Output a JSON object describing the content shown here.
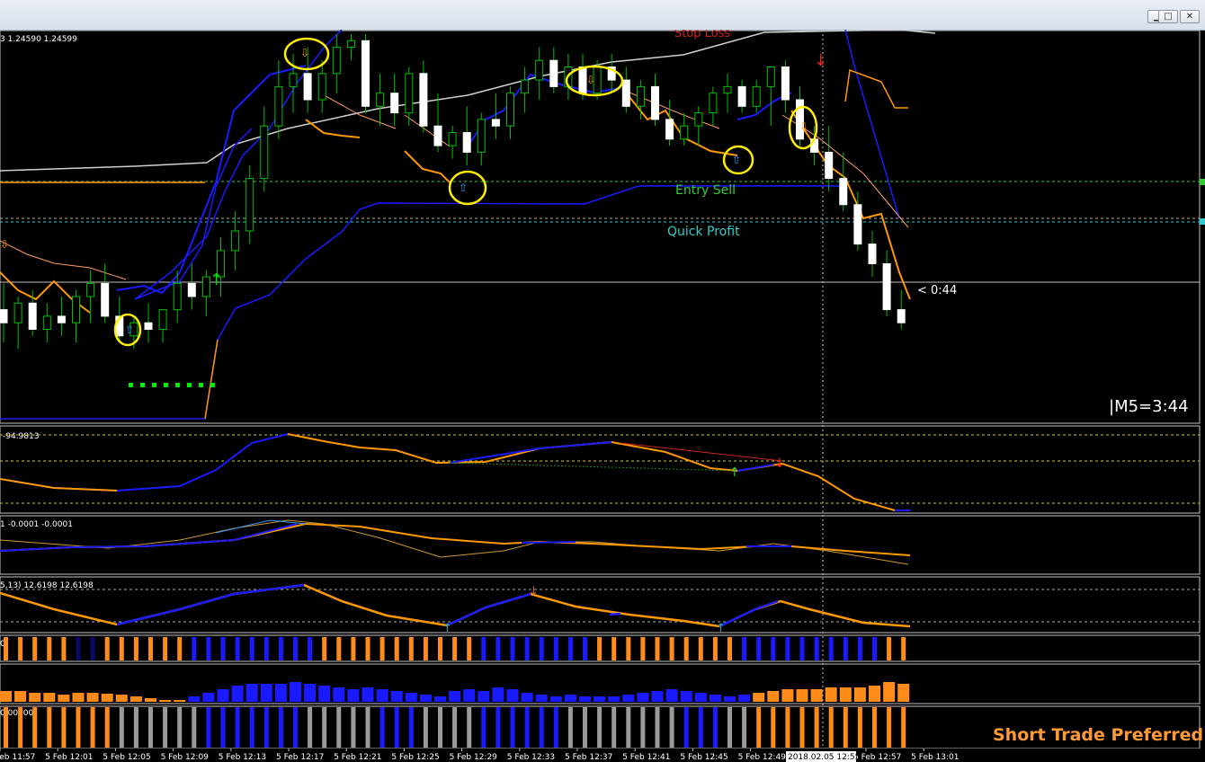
{
  "window": {
    "minimize_icon": "minimize-icon",
    "restore_icon": "restore-icon",
    "close_icon": "close-icon"
  },
  "main": {
    "price_readout": "3 1.24590 1.24599",
    "stop_loss_label": "Stop Loss",
    "entry_sell_label": "Entry Sell",
    "quick_profit_label": "Quick Profit",
    "countdown_label": "< 0:44",
    "timeframe_timer": "|M5=3:44",
    "colors": {
      "entry_sell": "#33cc33",
      "quick_profit": "#33cccc",
      "stop_loss": "#cc2222",
      "bull_candle": "#00c000",
      "bear_candle": "#ffffff"
    }
  },
  "panels": [
    {
      "name": "oscillator-1",
      "label": "-94.9813"
    },
    {
      "name": "oscillator-2",
      "label": "1  -0.0001 -0.0001"
    },
    {
      "name": "oscillator-3",
      "label": "5,13) 12.6198 12.6198"
    },
    {
      "name": "histogram-1",
      "label": "0"
    },
    {
      "name": "histogram-2",
      "label": ""
    },
    {
      "name": "histogram-3",
      "label": "0.00000",
      "overlay_text": "Short Trade Preferred"
    }
  ],
  "axis": {
    "time_labels": [
      "5 Feb 11:57",
      "5 Feb 12:01",
      "5 Feb 12:05",
      "5 Feb 12:09",
      "5 Feb 12:13",
      "5 Feb 12:17",
      "5 Feb 12:21",
      "5 Feb 12:25",
      "5 Feb 12:29",
      "5 Feb 12:33",
      "5 Feb 12:37",
      "5 Feb 12:41",
      "5 Feb 12:45",
      "5 Feb 12:49",
      "5 Feb 12:53",
      "5 Feb 12:57",
      "5 Feb 13:01"
    ],
    "crosshair_time": "2018.02.05 12:55"
  },
  "chart_data": {
    "type": "candlestick",
    "symbol_readout": "1.24590 1.24599",
    "timeframe": "M5",
    "candles": [
      {
        "o": 42,
        "h": 38,
        "l": 47,
        "c": 44
      },
      {
        "o": 44,
        "h": 40,
        "l": 48,
        "c": 41
      },
      {
        "o": 41,
        "h": 39,
        "l": 46,
        "c": 45
      },
      {
        "o": 45,
        "h": 41,
        "l": 47,
        "c": 43
      },
      {
        "o": 43,
        "h": 40,
        "l": 46,
        "c": 44
      },
      {
        "o": 44,
        "h": 39,
        "l": 47,
        "c": 40
      },
      {
        "o": 40,
        "h": 36,
        "l": 44,
        "c": 38
      },
      {
        "o": 38,
        "h": 35,
        "l": 44,
        "c": 43
      },
      {
        "o": 43,
        "h": 40,
        "l": 47,
        "c": 46
      },
      {
        "o": 46,
        "h": 43,
        "l": 48,
        "c": 44
      },
      {
        "o": 44,
        "h": 41,
        "l": 47,
        "c": 45
      },
      {
        "o": 45,
        "h": 42,
        "l": 47,
        "c": 42
      },
      {
        "o": 42,
        "h": 36,
        "l": 44,
        "c": 38
      },
      {
        "o": 38,
        "h": 35,
        "l": 42,
        "c": 40
      },
      {
        "o": 40,
        "h": 36,
        "l": 43,
        "c": 37
      },
      {
        "o": 37,
        "h": 31,
        "l": 40,
        "c": 33
      },
      {
        "o": 33,
        "h": 27,
        "l": 36,
        "c": 30
      },
      {
        "o": 30,
        "h": 20,
        "l": 32,
        "c": 22
      },
      {
        "o": 22,
        "h": 11,
        "l": 24,
        "c": 14
      },
      {
        "o": 14,
        "h": 4,
        "l": 16,
        "c": 8
      },
      {
        "o": 8,
        "h": 3,
        "l": 12,
        "c": 6
      },
      {
        "o": 6,
        "h": 2,
        "l": 12,
        "c": 10
      },
      {
        "o": 10,
        "h": 4,
        "l": 12,
        "c": 6
      },
      {
        "o": 6,
        "h": 0,
        "l": 9,
        "c": 2
      },
      {
        "o": 2,
        "h": 0,
        "l": 4,
        "c": 1
      },
      {
        "o": 1,
        "h": 0,
        "l": 12,
        "c": 11
      },
      {
        "o": 11,
        "h": 6,
        "l": 14,
        "c": 9
      },
      {
        "o": 9,
        "h": 6,
        "l": 14,
        "c": 12
      },
      {
        "o": 12,
        "h": 5,
        "l": 14,
        "c": 6
      },
      {
        "o": 6,
        "h": 4,
        "l": 15,
        "c": 14
      },
      {
        "o": 14,
        "h": 9,
        "l": 18,
        "c": 17
      },
      {
        "o": 17,
        "h": 14,
        "l": 19,
        "c": 15
      },
      {
        "o": 15,
        "h": 11,
        "l": 20,
        "c": 18
      },
      {
        "o": 18,
        "h": 12,
        "l": 20,
        "c": 13
      },
      {
        "o": 13,
        "h": 9,
        "l": 16,
        "c": 14
      },
      {
        "o": 14,
        "h": 8,
        "l": 16,
        "c": 9
      },
      {
        "o": 9,
        "h": 5,
        "l": 12,
        "c": 7
      },
      {
        "o": 7,
        "h": 2,
        "l": 10,
        "c": 4
      },
      {
        "o": 4,
        "h": 2,
        "l": 9,
        "c": 8
      },
      {
        "o": 8,
        "h": 3,
        "l": 10,
        "c": 5
      },
      {
        "o": 5,
        "h": 3,
        "l": 10,
        "c": 9
      },
      {
        "o": 9,
        "h": 4,
        "l": 10,
        "c": 5
      },
      {
        "o": 5,
        "h": 3,
        "l": 9,
        "c": 7
      },
      {
        "o": 7,
        "h": 5,
        "l": 12,
        "c": 11
      },
      {
        "o": 11,
        "h": 7,
        "l": 13,
        "c": 8
      },
      {
        "o": 8,
        "h": 6,
        "l": 14,
        "c": 13
      },
      {
        "o": 13,
        "h": 10,
        "l": 17,
        "c": 16
      },
      {
        "o": 16,
        "h": 12,
        "l": 17,
        "c": 14
      },
      {
        "o": 14,
        "h": 11,
        "l": 17,
        "c": 12
      },
      {
        "o": 12,
        "h": 8,
        "l": 14,
        "c": 9
      },
      {
        "o": 9,
        "h": 6,
        "l": 12,
        "c": 8
      },
      {
        "o": 8,
        "h": 7,
        "l": 12,
        "c": 11
      },
      {
        "o": 11,
        "h": 7,
        "l": 12,
        "c": 8
      },
      {
        "o": 8,
        "h": 6,
        "l": 14,
        "c": 5
      },
      {
        "o": 5,
        "h": 4,
        "l": 12,
        "c": 10
      },
      {
        "o": 10,
        "h": 8,
        "l": 17,
        "c": 16
      },
      {
        "o": 16,
        "h": 14,
        "l": 20,
        "c": 18
      },
      {
        "o": 18,
        "h": 14,
        "l": 24,
        "c": 22
      },
      {
        "o": 22,
        "h": 18,
        "l": 27,
        "c": 26
      },
      {
        "o": 26,
        "h": 24,
        "l": 33,
        "c": 32
      },
      {
        "o": 32,
        "h": 30,
        "l": 37,
        "c": 35
      },
      {
        "o": 35,
        "h": 33,
        "l": 43,
        "c": 42
      },
      {
        "o": 42,
        "h": 39,
        "l": 45,
        "c": 44
      }
    ],
    "price_levels": {
      "entry_sell": 22,
      "quick_profit": 28,
      "current": 37
    },
    "time_labels": [
      "5 Feb 11:57",
      "5 Feb 12:01",
      "5 Feb 12:05",
      "5 Feb 12:09",
      "5 Feb 12:13",
      "5 Feb 12:17",
      "5 Feb 12:21",
      "5 Feb 12:25",
      "5 Feb 12:29",
      "5 Feb 12:33",
      "5 Feb 12:37",
      "5 Feb 12:41",
      "5 Feb 12:45",
      "5 Feb 12:49",
      "5 Feb 12:53",
      "5 Feb 12:57",
      "5 Feb 13:01"
    ]
  }
}
